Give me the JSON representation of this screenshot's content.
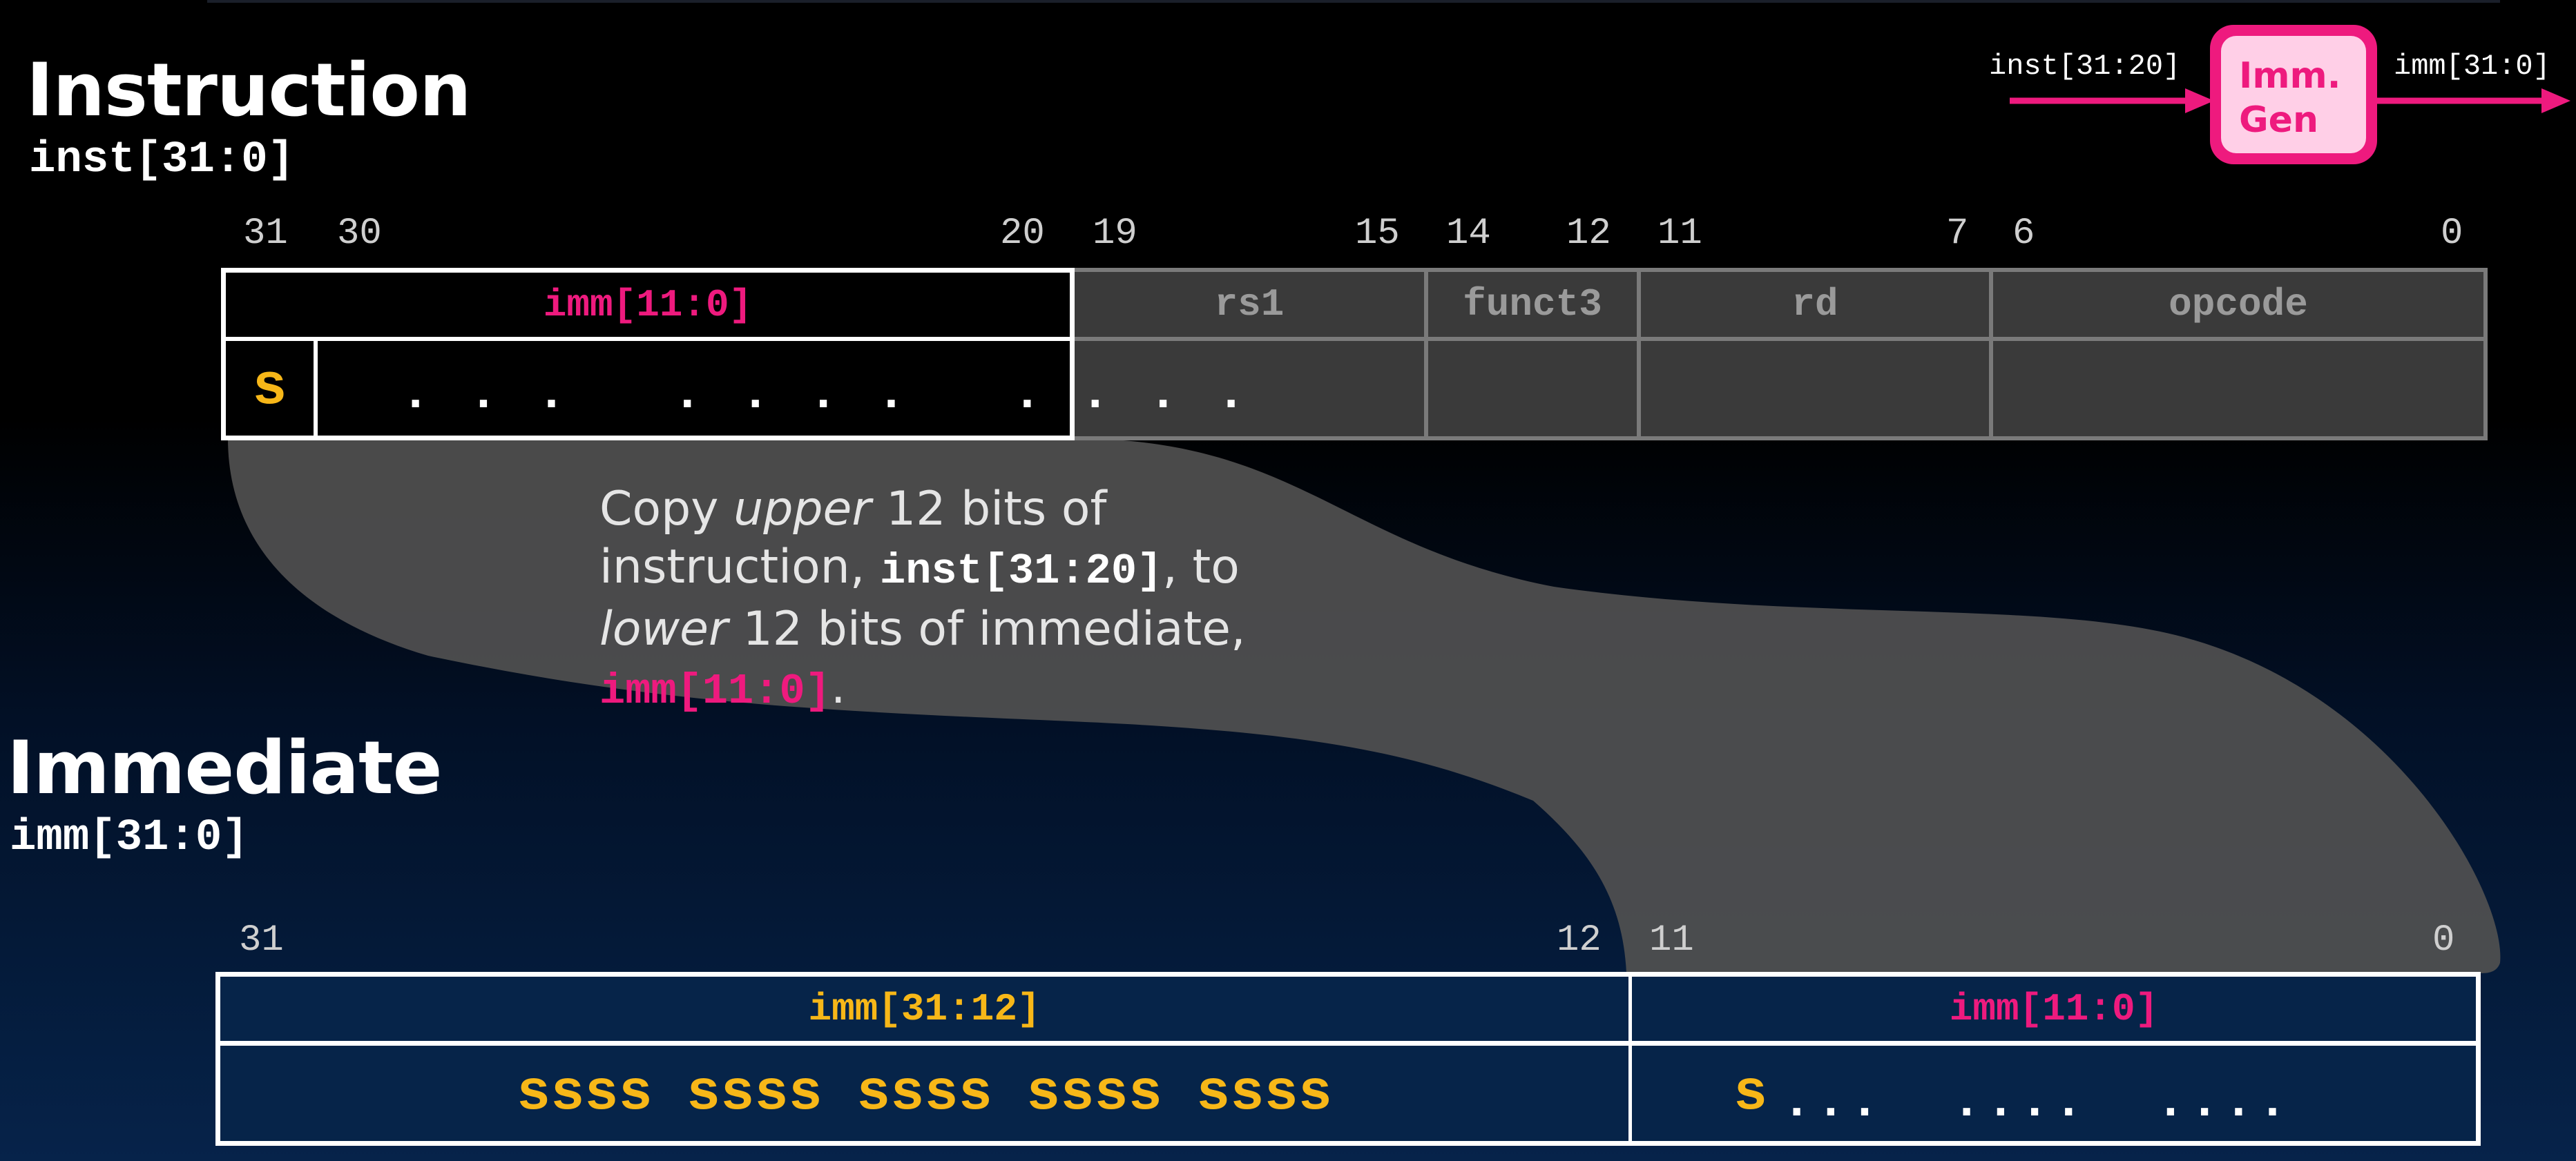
{
  "instruction": {
    "title": "Instruction",
    "subtitle": "inst[31:0]",
    "bit_numbers": [
      "31",
      "30",
      "20",
      "19",
      "15",
      "14",
      "12",
      "11",
      "7",
      "6",
      "0"
    ],
    "fields": {
      "imm": "imm[11:0]",
      "rs1": "rs1",
      "funct3": "funct3",
      "rd": "rd",
      "opcode": "opcode"
    },
    "sign_bit": "s",
    "dots": ". . .   . . . .   . . . ."
  },
  "immgen": {
    "input_label": "inst[31:20]",
    "output_label": "imm[31:0]",
    "box_line1": "Imm.",
    "box_line2": "Gen"
  },
  "explanation": {
    "p1": "Copy ",
    "upper": "upper",
    "p2": " 12 bits of",
    "p3": "instruction, ",
    "code1": "inst[31:20]",
    "p4": ", to",
    "lower": "lower",
    "p5": " 12 bits of immediate,",
    "code2": "imm[11:0]",
    "p6": "."
  },
  "immediate": {
    "title": "Immediate",
    "subtitle": "imm[31:0]",
    "bit_numbers": [
      "31",
      "12",
      "11",
      "0"
    ],
    "upper_header": "imm[31:12]",
    "lower_header": "imm[11:0]",
    "upper_value": "ssss ssss ssss ssss ssss",
    "lower_sign": "s",
    "lower_dots": "...  ....  ...."
  },
  "colors": {
    "accent_pink": "#ee1a7e",
    "sign_gold": "#f7b718",
    "muted_grey": "#8a8a8a",
    "imm_fill": "#062449"
  }
}
